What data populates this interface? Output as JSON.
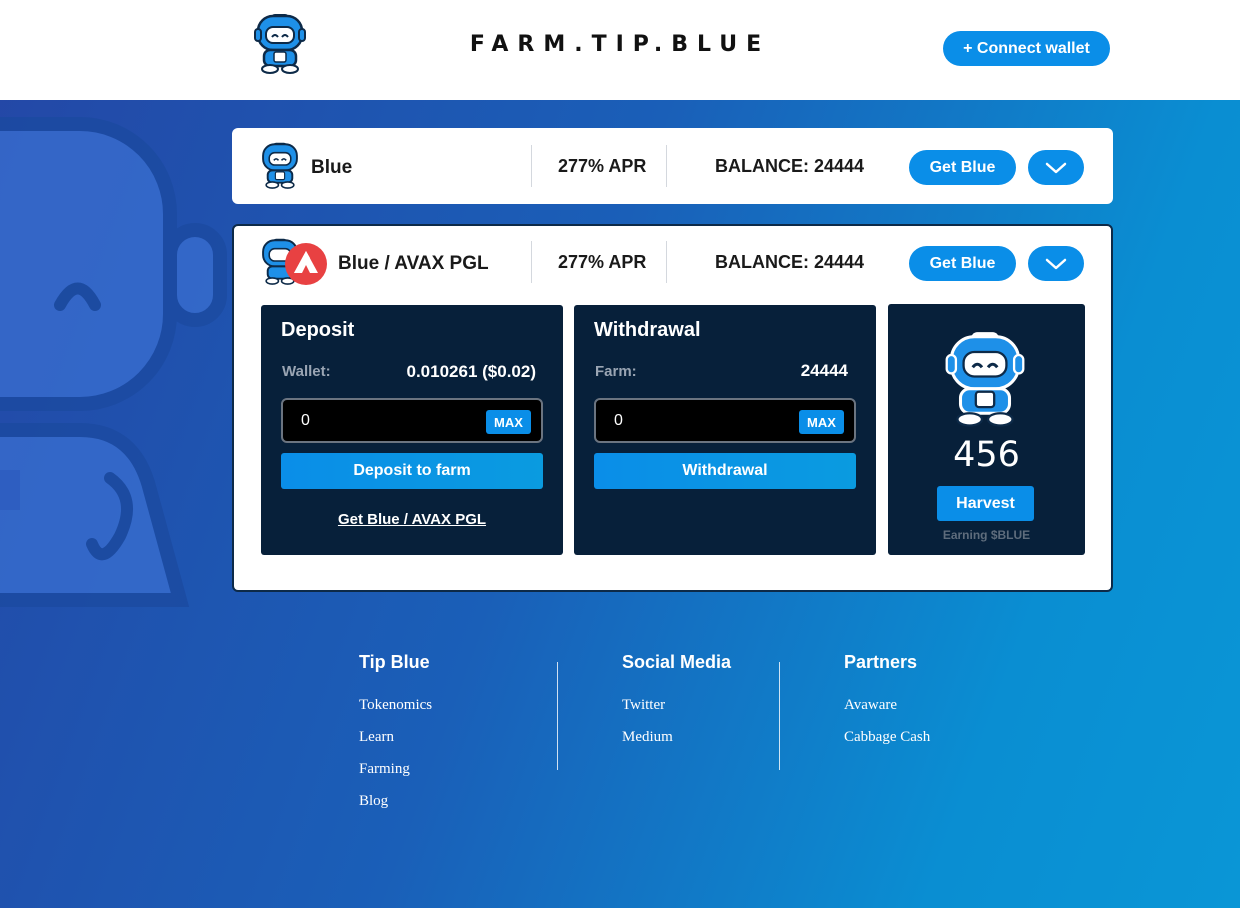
{
  "header": {
    "title": "FARM.TIP.BLUE",
    "connect_label": "+ Connect wallet"
  },
  "farms": [
    {
      "name": "Blue",
      "apr": "277% APR",
      "balance": "BALANCE: 24444",
      "get_label": "Get Blue"
    },
    {
      "name": "Blue / AVAX PGL",
      "apr": "277% APR",
      "balance": "BALANCE: 24444",
      "get_label": "Get Blue",
      "deposit": {
        "title": "Deposit",
        "wallet_label": "Wallet:",
        "wallet_value": "0.010261 ($0.02)",
        "input_value": "0",
        "max_label": "MAX",
        "button_label": "Deposit to farm",
        "get_link": "Get Blue / AVAX PGL"
      },
      "withdrawal": {
        "title": "Withdrawal",
        "farm_label": "Farm:",
        "farm_value": "24444",
        "input_value": "0",
        "max_label": "MAX",
        "button_label": "Withdrawal"
      },
      "harvest": {
        "amount": "456",
        "button_label": "Harvest",
        "earning_label": "Earning $BLUE"
      }
    }
  ],
  "footer": {
    "columns": [
      {
        "title": "Tip Blue",
        "links": [
          "Tokenomics",
          "Learn",
          "Farming",
          "Blog"
        ]
      },
      {
        "title": "Social Media",
        "links": [
          "Twitter",
          "Medium"
        ]
      },
      {
        "title": "Partners",
        "links": [
          "Avaware",
          "Cabbage Cash"
        ]
      }
    ]
  },
  "colors": {
    "accent": "#0a8ee8",
    "panel": "#07203a",
    "avax_red": "#e84142"
  },
  "icons": [
    "robot-mascot-icon",
    "avax-icon",
    "chevron-down-icon"
  ]
}
